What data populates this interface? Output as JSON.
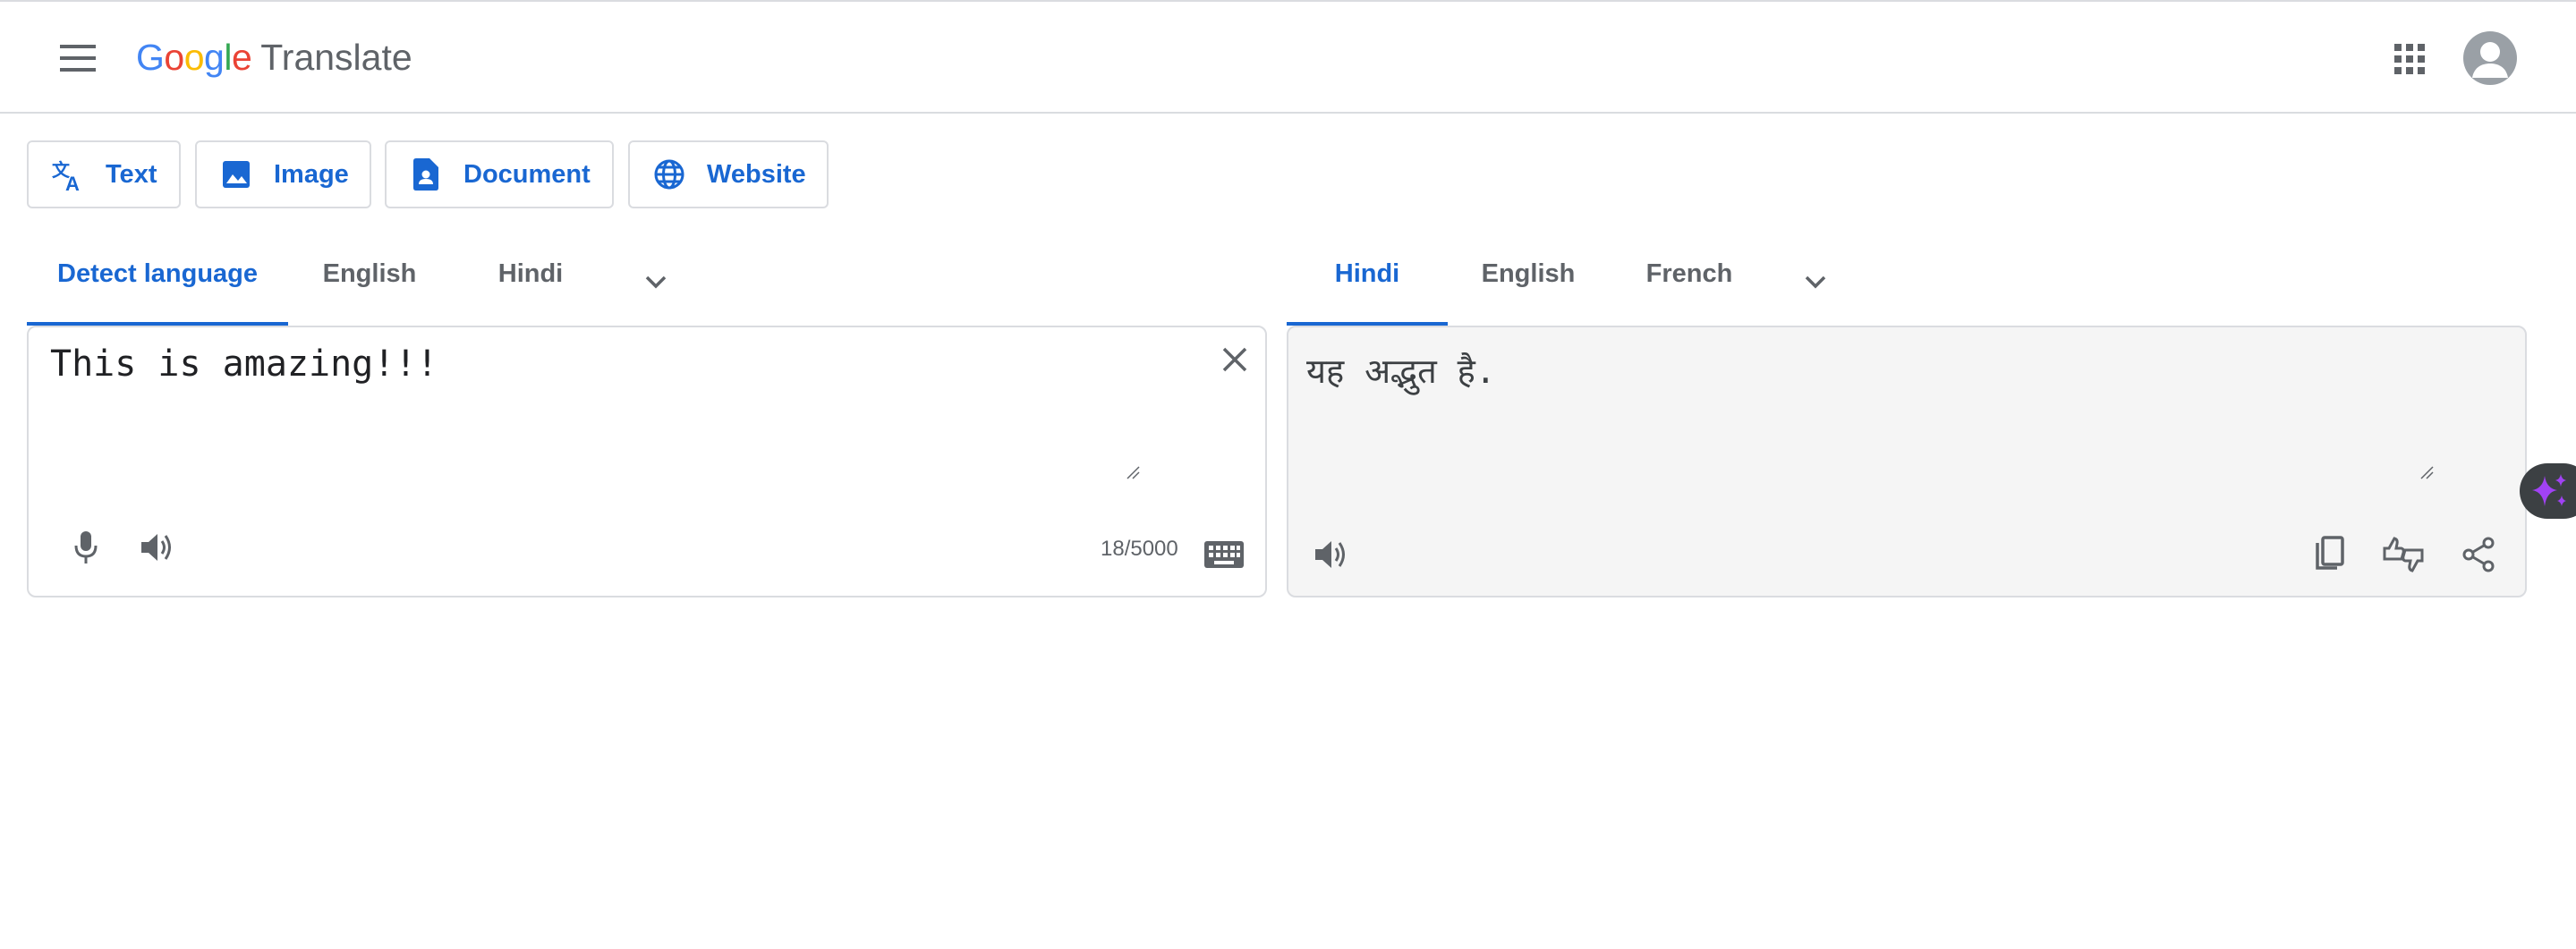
{
  "app": {
    "logo_google": [
      "G",
      "o",
      "o",
      "g",
      "l",
      "e"
    ],
    "logo_product": "Translate"
  },
  "header": {
    "menu_icon": "hamburger-menu-icon",
    "apps_icon": "apps-grid-icon",
    "account_icon": "account-avatar-icon"
  },
  "modes": [
    {
      "label": "Text",
      "icon": "translate-icon"
    },
    {
      "label": "Image",
      "icon": "image-icon"
    },
    {
      "label": "Document",
      "icon": "document-icon"
    },
    {
      "label": "Website",
      "icon": "globe-icon"
    }
  ],
  "source": {
    "tabs": [
      {
        "label": "Detect language",
        "active": true
      },
      {
        "label": "English",
        "active": false
      },
      {
        "label": "Hindi",
        "active": false
      }
    ],
    "text": "This is amazing!!!",
    "char_count": "18/5000",
    "icons": [
      "clear-icon",
      "microphone-icon",
      "speaker-icon",
      "keyboard-icon"
    ]
  },
  "target": {
    "tabs": [
      {
        "label": "Hindi",
        "active": true
      },
      {
        "label": "English",
        "active": false
      },
      {
        "label": "French",
        "active": false
      }
    ],
    "text": "यह अद्भुत है.",
    "icons": [
      "speaker-icon",
      "copy-icon",
      "rate-translation-icon",
      "share-icon"
    ]
  },
  "side_tab": {
    "icon": "sparkle-icon"
  },
  "colors": {
    "accent": "#1967d2",
    "text_secondary": "#5f6368",
    "border": "#dadce0",
    "target_bg": "#f5f5f5",
    "sparkle": "#a142f4"
  }
}
